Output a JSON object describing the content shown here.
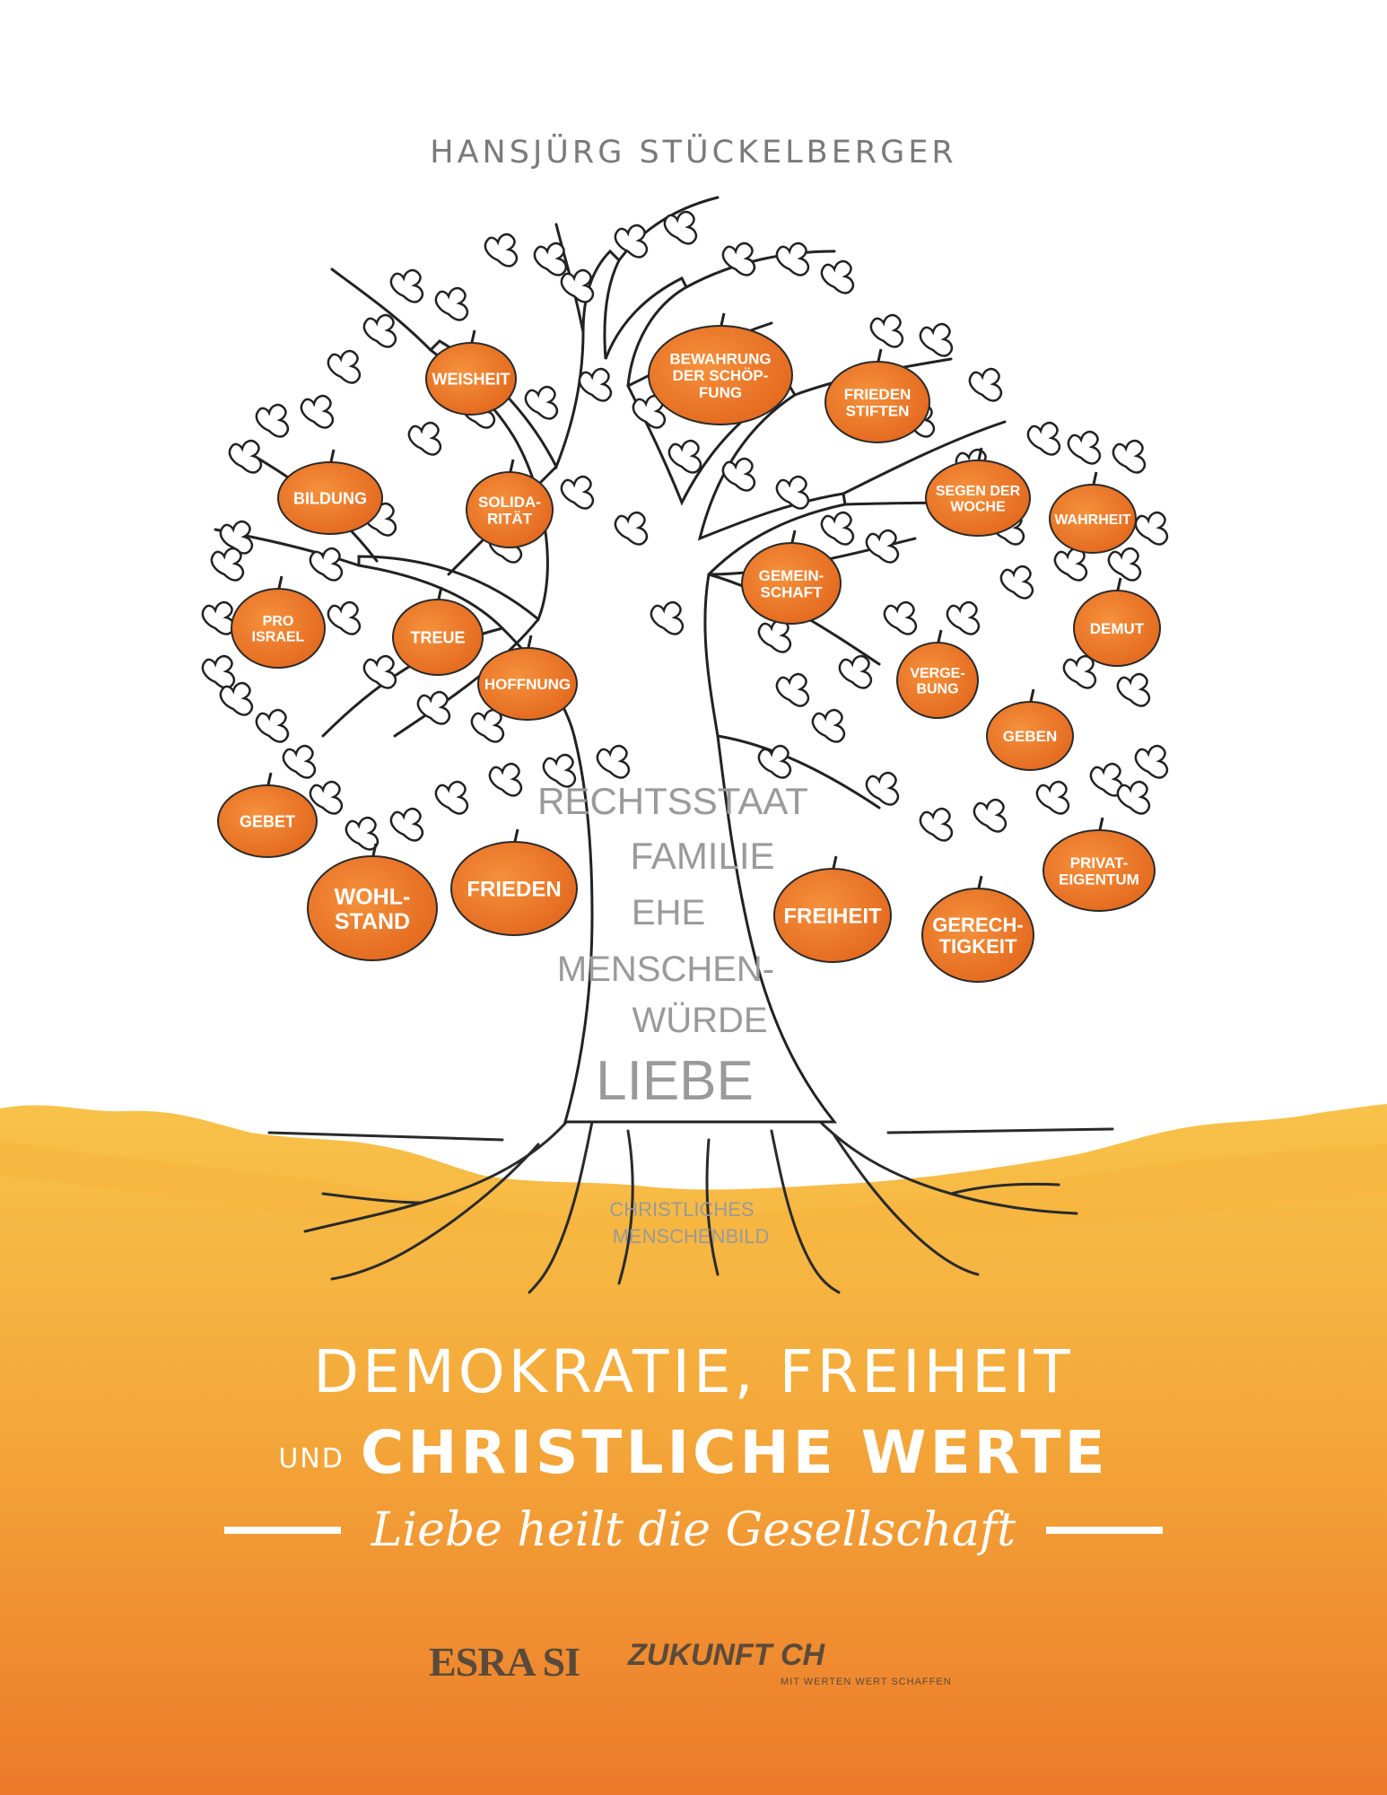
{
  "cover": {
    "author": "HANSJÜRG STÜCKELBERGER",
    "title_line1": "DEMOKRATIE, FREIHEIT",
    "title_und": "UND",
    "title_line2": "CHRISTLICHE WERTE",
    "subtitle": "Liebe heilt die Gesellschaft",
    "publisher_1": "ESRA SI",
    "publisher_2": "ZUKUNFT CH",
    "publisher_2_tagline": "MIT WERTEN WERT SCHAFFEN"
  },
  "tree": {
    "fruits": [
      {
        "id": "weisheit",
        "lines": [
          "WEISHEIT"
        ]
      },
      {
        "id": "bewahrung",
        "lines": [
          "BEWAHRUNG",
          "DER SCHÖP-",
          "FUNG"
        ]
      },
      {
        "id": "frieden-stiften",
        "lines": [
          "FRIEDEN",
          "STIFTEN"
        ]
      },
      {
        "id": "bildung",
        "lines": [
          "BILDUNG"
        ]
      },
      {
        "id": "solidaritaet",
        "lines": [
          "SOLIDA-",
          "RITÄT"
        ]
      },
      {
        "id": "segen",
        "lines": [
          "SEGEN DER",
          "WOCHE"
        ]
      },
      {
        "id": "wahrheit",
        "lines": [
          "WAHRHEIT"
        ]
      },
      {
        "id": "gemeinschaft",
        "lines": [
          "GEMEIN-",
          "SCHAFT"
        ]
      },
      {
        "id": "pro-israel",
        "lines": [
          "PRO",
          "ISRAEL"
        ]
      },
      {
        "id": "treue",
        "lines": [
          "TREUE"
        ]
      },
      {
        "id": "demut",
        "lines": [
          "DEMUT"
        ]
      },
      {
        "id": "hoffnung",
        "lines": [
          "HOFFNUNG"
        ]
      },
      {
        "id": "vergebung",
        "lines": [
          "VERGE-",
          "BUNG"
        ]
      },
      {
        "id": "geben",
        "lines": [
          "GEBEN"
        ]
      },
      {
        "id": "gebet",
        "lines": [
          "GEBET"
        ]
      },
      {
        "id": "privateigentum",
        "lines": [
          "PRIVAT-",
          "EIGENTUM"
        ]
      },
      {
        "id": "wohlstand",
        "lines": [
          "WOHL-",
          "STAND"
        ]
      },
      {
        "id": "frieden",
        "lines": [
          "FRIEDEN"
        ]
      },
      {
        "id": "freiheit",
        "lines": [
          "FREIHEIT"
        ]
      },
      {
        "id": "gerechtigkeit",
        "lines": [
          "GERECH-",
          "TIGKEIT"
        ]
      }
    ],
    "trunk_words": [
      {
        "id": "rechtsstaat",
        "text": "RECHTSSTAAT"
      },
      {
        "id": "familie",
        "text": "FAMILIE"
      },
      {
        "id": "ehe",
        "text": "EHE"
      },
      {
        "id": "menschen",
        "text": "MENSCHEN-"
      },
      {
        "id": "wuerde",
        "text": "WÜRDE"
      },
      {
        "id": "liebe",
        "text": "LIEBE"
      }
    ],
    "root_lines": [
      "CHRISTLICHES",
      "MENSCHENBILD"
    ]
  },
  "colors": {
    "fruit": "#ef7d2d",
    "fruit_dark": "#d9621a",
    "ground_top": "#f6b93b",
    "ground_bottom": "#ee7f2a",
    "ink": "#222222",
    "trunk_text": "#9a9a9a",
    "author": "#7a7a7a"
  }
}
